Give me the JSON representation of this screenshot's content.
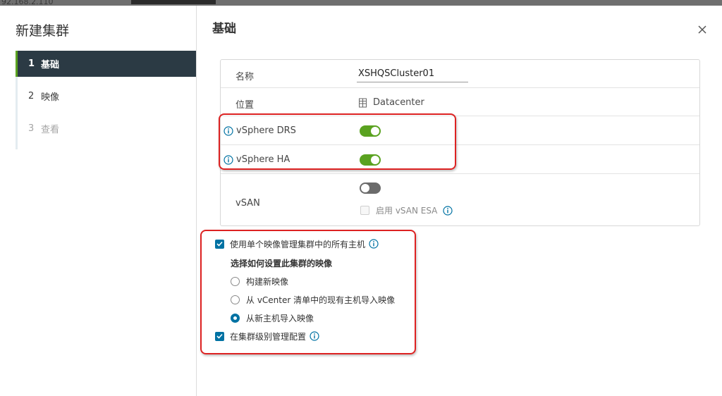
{
  "background": {
    "ip_text": "92.168.2.110"
  },
  "wizard": {
    "title": "新建集群",
    "steps": [
      {
        "num": "1",
        "label": "基础"
      },
      {
        "num": "2",
        "label": "映像"
      },
      {
        "num": "3",
        "label": "查看"
      }
    ]
  },
  "page": {
    "title": "基础"
  },
  "form": {
    "name_label": "名称",
    "name_value": "XSHQSCluster01",
    "location_label": "位置",
    "location_value": "Datacenter",
    "drs_label": "vSphere DRS",
    "drs_enabled": true,
    "ha_label": "vSphere HA",
    "ha_enabled": true,
    "vsan_label": "vSAN",
    "vsan_enabled": false,
    "vsan_esa_label": "启用 vSAN ESA"
  },
  "image_options": {
    "single_image_label": "使用单个映像管理集群中的所有主机",
    "setup_title": "选择如何设置此集群的映像",
    "radio_new": "构建新映像",
    "radio_vcenter": "从 vCenter 清单中的现有主机导入映像",
    "radio_host": "从新主机导入映像",
    "selected_radio": "radio_host",
    "cluster_config_label": "在集群级别管理配置"
  },
  "colors": {
    "accent": "#0072a3",
    "toggle_on": "#5aa220",
    "highlight": "#dd2222"
  }
}
